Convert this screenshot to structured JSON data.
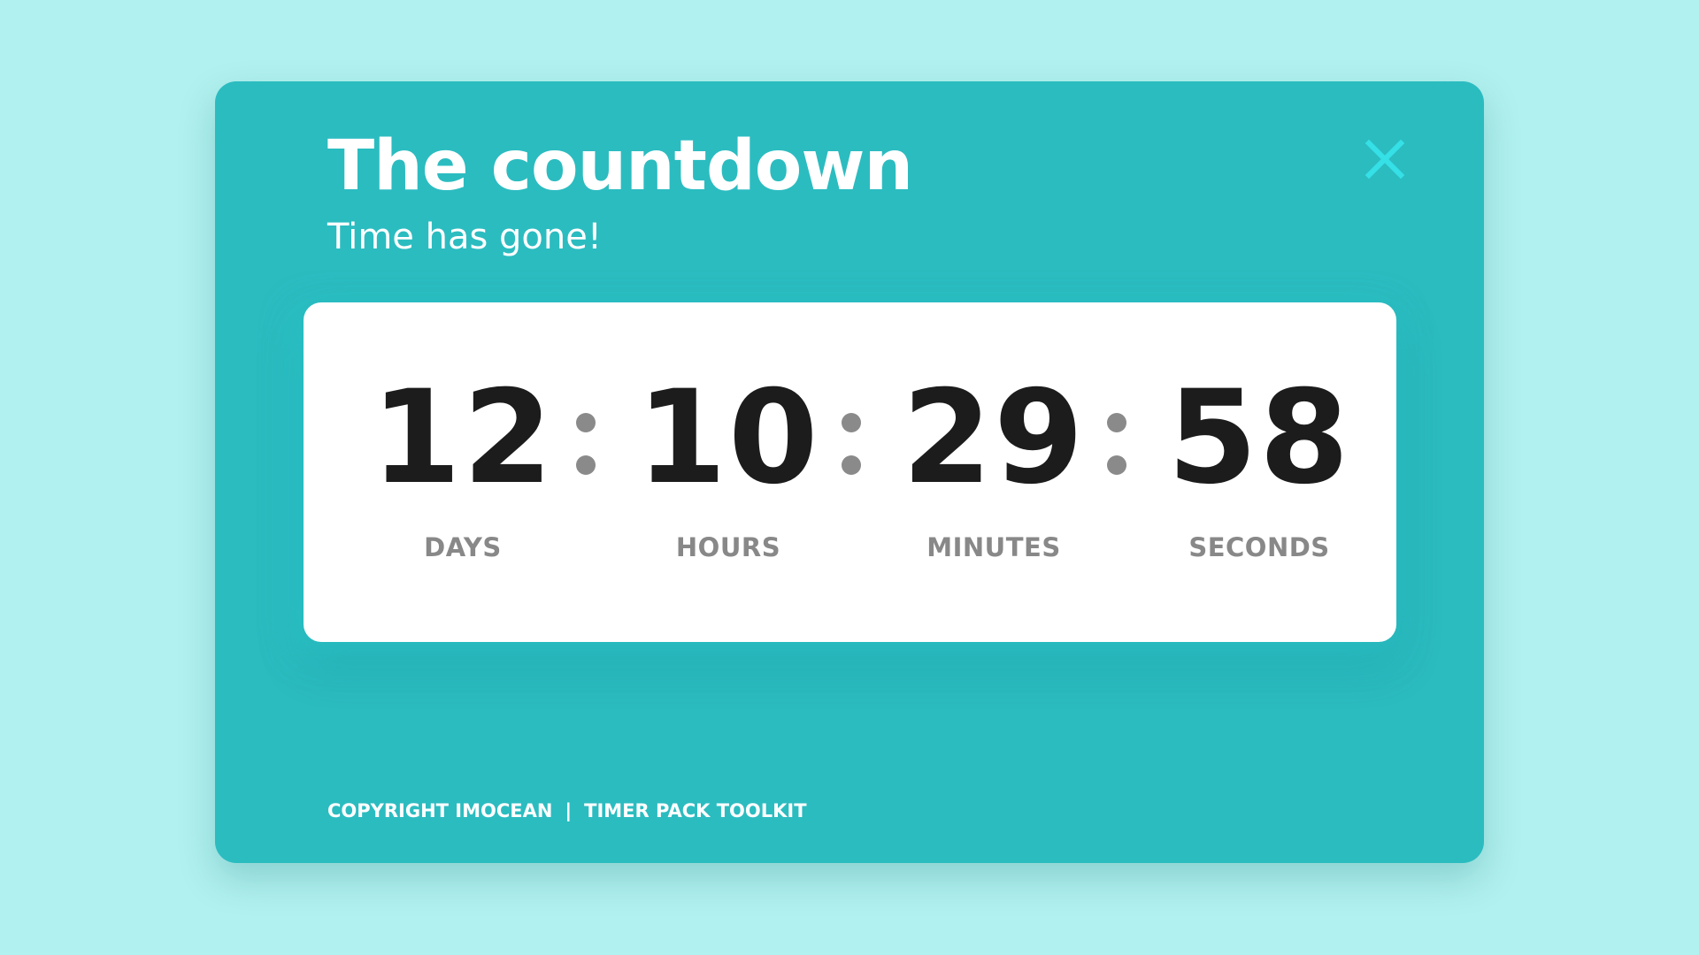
{
  "colors": {
    "background": "#b1f1ef",
    "card": "#2bbcc0",
    "panel": "#ffffff",
    "digits": "#1c1c1c",
    "labels": "#888888",
    "close_icon": "#35e0e6"
  },
  "header": {
    "title": "The countdown",
    "subtitle": "Time has gone!",
    "close_icon": "close-icon"
  },
  "timer": {
    "days": {
      "value": "12",
      "label": "DAYS"
    },
    "hours": {
      "value": "10",
      "label": "HOURS"
    },
    "minutes": {
      "value": "29",
      "label": "MINUTES"
    },
    "seconds": {
      "value": "58",
      "label": "SECONDS"
    }
  },
  "footer": {
    "copyright": "COPYRIGHT IMOCEAN",
    "divider": "|",
    "product": "TIMER PACK TOOLKIT"
  }
}
